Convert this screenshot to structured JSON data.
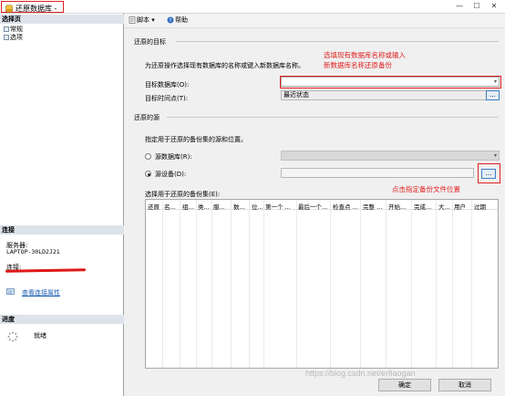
{
  "window": {
    "title": "还原数据库 -",
    "minimize": "—",
    "maximize": "☐",
    "close": "✕"
  },
  "left": {
    "select_page_header": "选择页",
    "pages": [
      "常规",
      "选项"
    ],
    "connection_header": "连接",
    "server_label": "服务器:",
    "server_value": "LAPTOP-30LD2J21",
    "connection_label": "连接:",
    "view_conn_props": "查看连接属性",
    "progress_header": "进度",
    "status": "就绪"
  },
  "toolbar": {
    "script": "脚本",
    "help": "帮助"
  },
  "restore_target": {
    "group": "还原的目标",
    "description": "为还原操作选择现有数据库的名称或键入新数据库名称。",
    "target_db_label": "目标数据库(O):",
    "target_db_value": "",
    "point_in_time_label": "目标时间点(T):",
    "point_in_time_value": "最近状态"
  },
  "restore_source": {
    "group": "还原的源",
    "description": "指定用于还原的备份集的源和位置。",
    "source_db_label": "源数据库(R):",
    "source_device_label": "源设备(D):",
    "browse": "...",
    "backup_sets_label": "选择用于还原的备份集(E):",
    "columns": [
      "还原",
      "名...",
      "组...",
      "类...",
      "服...",
      "数...",
      "位...",
      "第一个 ...",
      "最后一个...",
      "检查点 ...",
      "完整 ...",
      "开始...",
      "完成...",
      "大...",
      "用户",
      "过期"
    ]
  },
  "annotations": {
    "target_note_1": "选填现有数据库名称或输入",
    "target_note_2": "新数据库名称还原备份",
    "browse_note": "点击指定备份文件位置"
  },
  "buttons": {
    "ok": "确定",
    "cancel": "取消"
  },
  "watermark": "https://blog.csdn.net/erfiaogan",
  "colors": {
    "annotation_red": "#e02020",
    "link_blue": "#1a5fb4"
  }
}
